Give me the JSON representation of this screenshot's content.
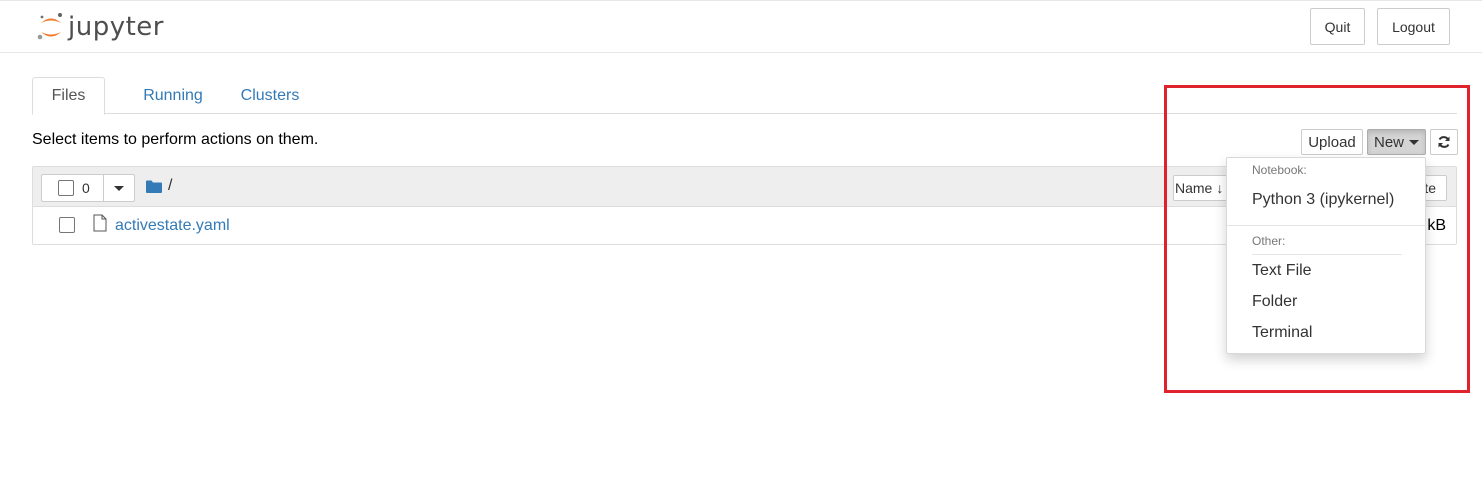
{
  "app": {
    "name": "jupyter",
    "brand_colors": {
      "orange": "#f37726",
      "gray": "#616262"
    }
  },
  "header": {
    "quit_label": "Quit",
    "logout_label": "Logout"
  },
  "tabs": [
    {
      "label": "Files",
      "active": true
    },
    {
      "label": "Running",
      "active": false
    },
    {
      "label": "Clusters",
      "active": false
    }
  ],
  "toolbar": {
    "hint": "Select items to perform actions on them.",
    "upload_label": "Upload",
    "new_label": "New",
    "refresh_icon": "refresh-icon"
  },
  "file_list": {
    "selected_count": "0",
    "breadcrumb": "/",
    "sort_name_label": "Name",
    "sort_date_label": "te",
    "rows": [
      {
        "name": "activestate.yaml",
        "size": "kB",
        "icon": "file-icon"
      }
    ]
  },
  "new_menu": {
    "notebook_header": "Notebook:",
    "notebook_items": [
      "Python 3 (ipykernel)"
    ],
    "other_header": "Other:",
    "other_items": [
      "Text File",
      "Folder",
      "Terminal"
    ]
  },
  "highlight_color": "#e0222c"
}
